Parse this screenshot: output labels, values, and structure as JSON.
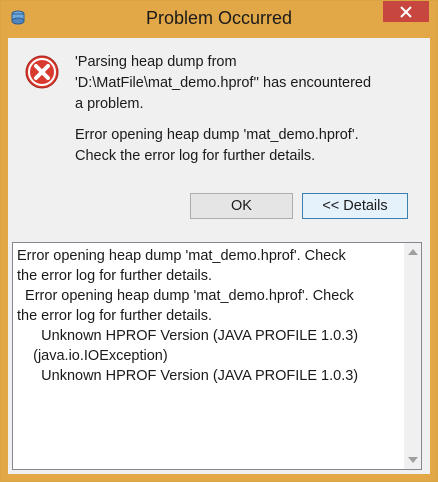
{
  "window": {
    "title": "Problem Occurred",
    "accent_color": "#e2a848",
    "close_color": "#c7463f"
  },
  "message": {
    "line1": "'Parsing heap dump from",
    "line2": "'D:\\MatFile\\mat_demo.hprof'' has encountered",
    "line3": "a problem.",
    "line4": "Error opening heap dump 'mat_demo.hprof'.",
    "line5": "Check the error log for further details."
  },
  "buttons": {
    "ok": "OK",
    "details": "<< Details"
  },
  "details": {
    "text": "Error opening heap dump 'mat_demo.hprof'. Check\nthe error log for further details.\n  Error opening heap dump 'mat_demo.hprof'. Check\nthe error log for further details.\n      Unknown HPROF Version (JAVA PROFILE 1.0.3)\n    (java.io.IOException)\n      Unknown HPROF Version (JAVA PROFILE 1.0.3)"
  },
  "icons": {
    "app": "eclipse-mat-icon",
    "error": "error-icon",
    "close": "close-icon"
  }
}
